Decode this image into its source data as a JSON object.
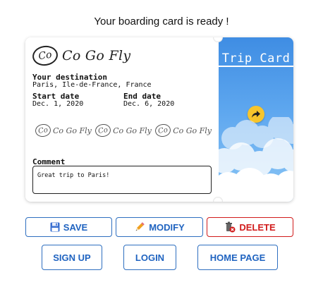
{
  "header": {
    "title": "Your boarding card is ready !"
  },
  "ticket": {
    "logo": {
      "mark": "Co",
      "text": "Co Go Fly"
    },
    "destination_label": "Your destination",
    "destination_value": "Paris, Ile-de-France, France",
    "start_label": "Start date",
    "start_value": "Dec. 1, 2020",
    "end_label": "End date",
    "end_value": "Dec. 6, 2020",
    "stamps": [
      {
        "mark": "Co",
        "text": "Co Go Fly"
      },
      {
        "mark": "Co",
        "text": "Co Go Fly"
      },
      {
        "mark": "Co",
        "text": "Co Go Fly"
      }
    ],
    "comment_label": "Comment",
    "comment_value": "Great trip to Paris!",
    "side_title": "Trip Card",
    "share_icon": "share-arrow-icon"
  },
  "actions": {
    "save_label": "SAVE",
    "modify_label": "MODIFY",
    "delete_label": "DELETE",
    "signup_label": "SIGN UP",
    "login_label": "LOGIN",
    "home_label": "HOME PAGE"
  },
  "colors": {
    "primary": "#1f63c0",
    "danger": "#d11b1b",
    "sky": "#3f8de3",
    "share": "#f7c52c"
  }
}
